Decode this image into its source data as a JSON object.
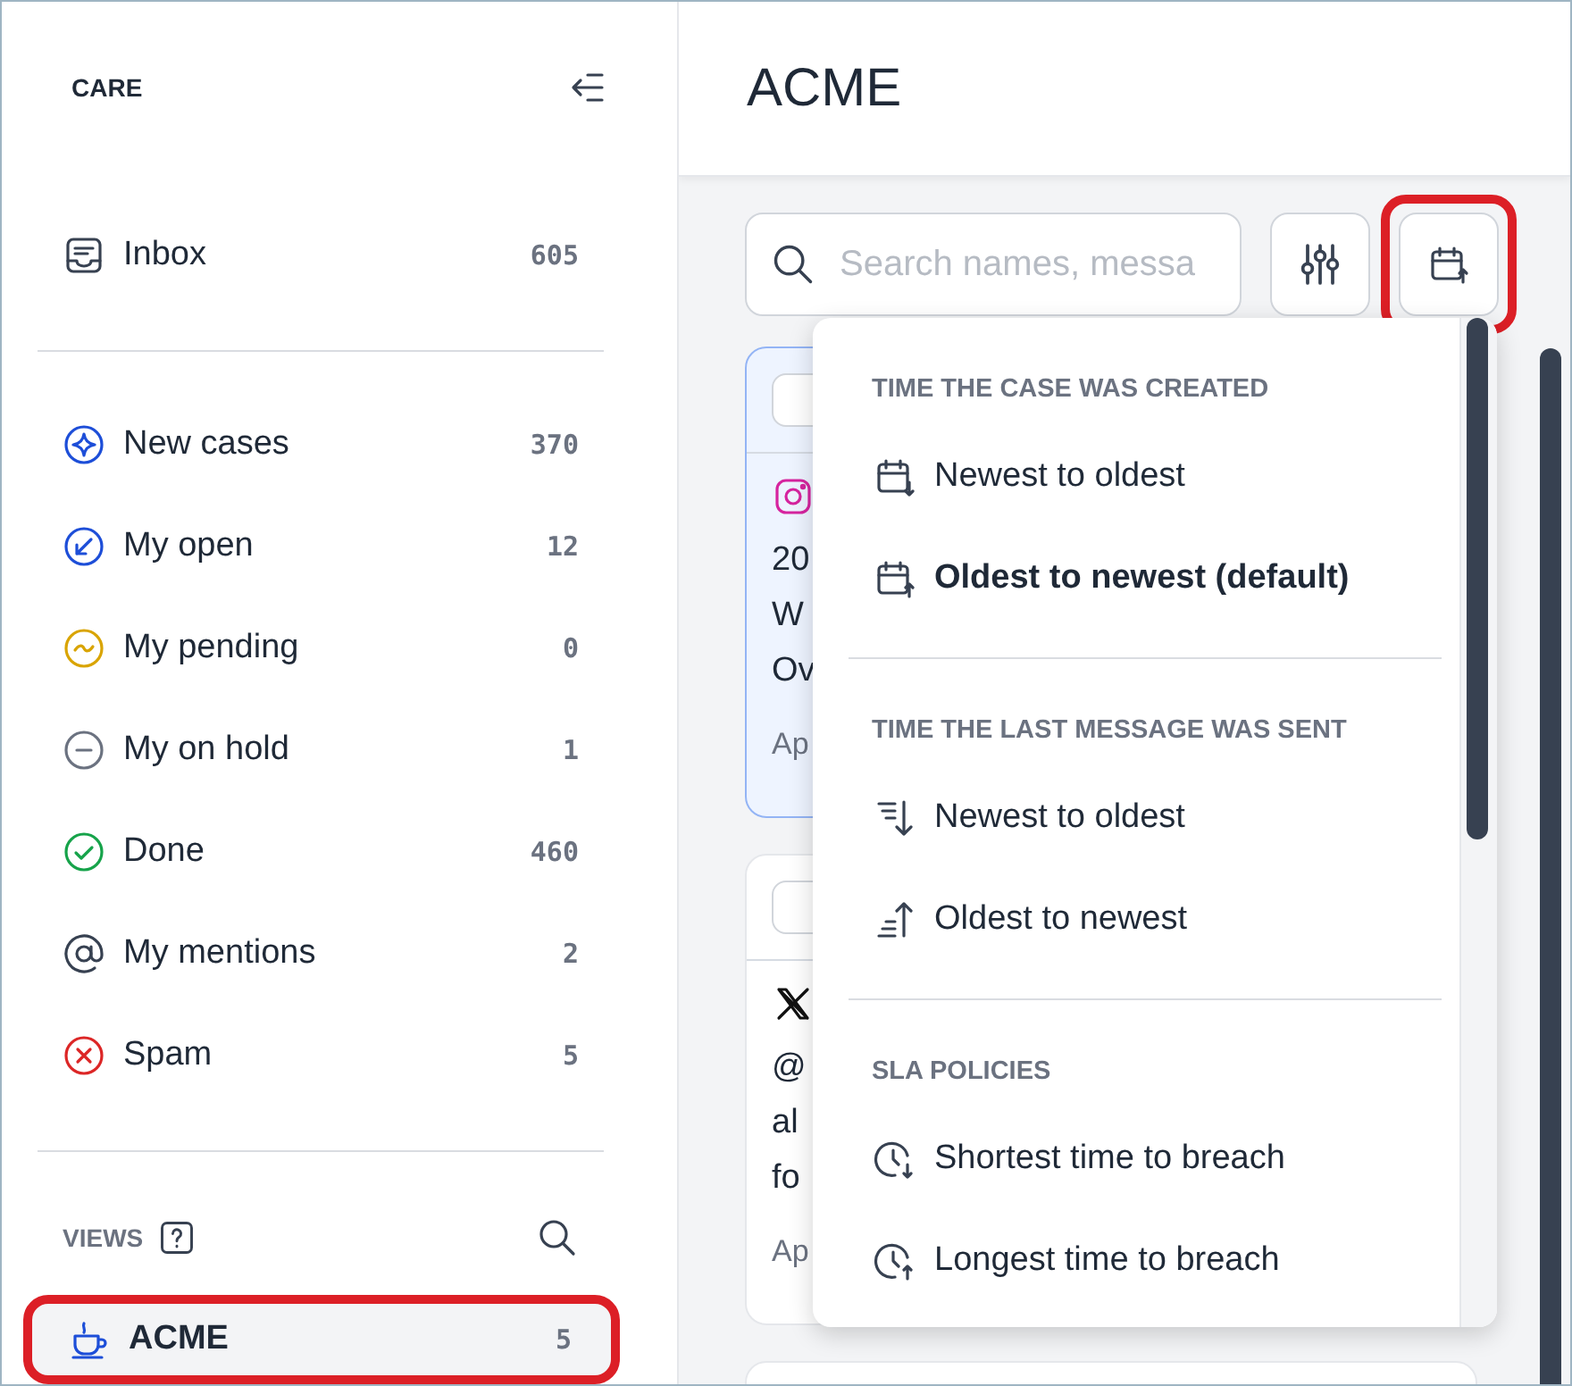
{
  "sidebar": {
    "title": "CARE",
    "inbox": {
      "label": "Inbox",
      "count": "605"
    },
    "items": [
      {
        "label": "New cases",
        "count": "370",
        "color": "#1d4ed8"
      },
      {
        "label": "My open",
        "count": "12",
        "color": "#1d4ed8"
      },
      {
        "label": "My pending",
        "count": "0",
        "color": "#d9a400"
      },
      {
        "label": "My on hold",
        "count": "1",
        "color": "#6b7280"
      },
      {
        "label": "Done",
        "count": "460",
        "color": "#16a34a"
      },
      {
        "label": "My mentions",
        "count": "2",
        "color": "#374151"
      },
      {
        "label": "Spam",
        "count": "5",
        "color": "#dc2626"
      }
    ],
    "views_label": "VIEWS",
    "views": [
      {
        "label": "ACME",
        "count": "5",
        "selected": true,
        "highlighted": true
      }
    ]
  },
  "main": {
    "title": "ACME",
    "search": {
      "placeholder": "Search names, messa"
    },
    "sort_button": {
      "highlighted": true
    },
    "cards": [
      {
        "kind": "instagram",
        "selected": true,
        "lines": [
          "20",
          "W",
          "Ov"
        ],
        "date": "Ap"
      },
      {
        "kind": "x",
        "selected": false,
        "lines": [
          "@",
          "al",
          "fo"
        ],
        "date": "Ap"
      },
      {
        "kind": "plain",
        "selected": false
      }
    ],
    "sort_menu": [
      {
        "heading": "TIME THE CASE WAS CREATED",
        "options": [
          {
            "label": "Newest to oldest",
            "kind": "calendar-down",
            "selected": false
          },
          {
            "label": "Oldest to newest (default)",
            "kind": "calendar-up",
            "selected": true
          }
        ]
      },
      {
        "heading": "TIME THE LAST MESSAGE WAS SENT",
        "options": [
          {
            "label": "Newest to oldest",
            "kind": "lines-down",
            "selected": false
          },
          {
            "label": "Oldest to newest",
            "kind": "lines-up",
            "selected": false
          }
        ]
      },
      {
        "heading": "SLA POLICIES",
        "options": [
          {
            "label": "Shortest time to breach",
            "kind": "clock-down",
            "selected": false
          },
          {
            "label": "Longest time to breach",
            "kind": "clock-up",
            "selected": false
          }
        ]
      }
    ]
  }
}
